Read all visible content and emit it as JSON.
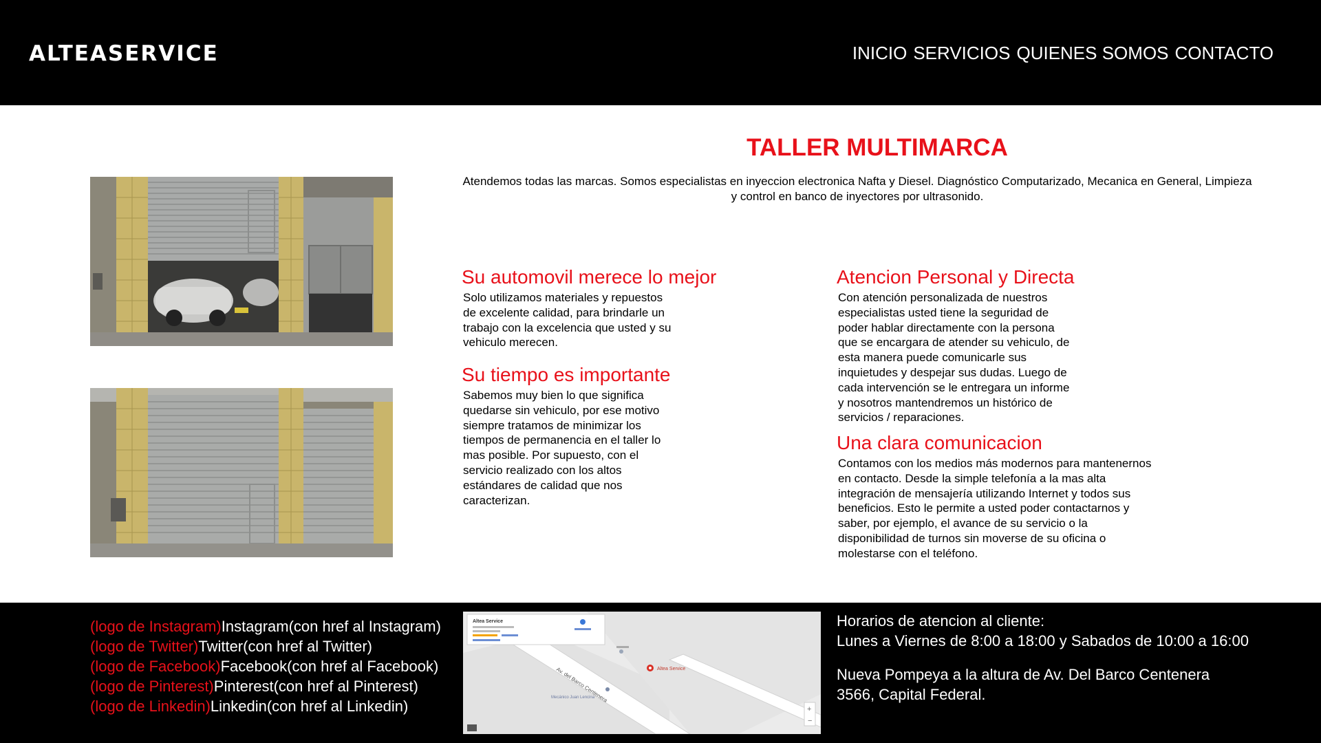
{
  "header": {
    "logo": "ALTEASERVICE",
    "nav": [
      "INICIO",
      "SERVICIOS",
      "QUIENES SOMOS",
      "CONTACTO"
    ]
  },
  "main": {
    "title": "TALLER MULTIMARCA",
    "intro": "Atendemos todas las marcas. Somos especialistas en inyeccion electronica Nafta y Diesel. Diagnóstico Computarizado, Mecanica en General, Limpieza y control en banco de inyectores por ultrasonido.",
    "features": [
      {
        "heading": "Su automovil merece lo mejor",
        "text": "Solo utilizamos materiales y repuestos de excelente calidad, para brindarle un trabajo con la excelencia que usted y su vehiculo merecen."
      },
      {
        "heading": "Su tiempo es importante",
        "text": "Sabemos muy bien lo que significa quedarse sin vehiculo, por ese motivo siempre tratamos de minimizar los tiempos de permanencia en el taller lo mas posible. Por supuesto, con el servicio realizado con los altos estándares de calidad que nos caracterizan."
      },
      {
        "heading": "Atencion Personal y Directa",
        "text": "Con atención personalizada de nuestros especialistas usted tiene la seguridad de poder hablar directamente con la persona que se encargara de atender su vehiculo, de esta manera puede comunicarle sus inquietudes y despejar sus dudas. Luego de cada intervención se le entregara un informe y nosotros mantendremos un histórico de servicios / reparaciones."
      },
      {
        "heading": "Una clara comunicacion",
        "text": "Contamos con los medios más modernos para mantenernos en contacto. Desde la simple telefonía a la mas alta integración de mensajería utilizando Internet y todos sus beneficios. Esto le permite a usted poder contactarnos y saber, por ejemplo, el avance de su servicio o la disponibilidad de turnos sin moverse de su oficina o molestarse con el teléfono."
      }
    ]
  },
  "footer": {
    "socials": [
      {
        "logo": "(logo de Instagram)",
        "label": "Instagram(con href al Instagram)",
        "icon": "instagram-icon"
      },
      {
        "logo": "(logo de Twitter)",
        "label": "Twitter(con href al Twitter)",
        "icon": "twitter-icon"
      },
      {
        "logo": "(logo de Facebook)",
        "label": "Facebook(con href al Facebook)",
        "icon": "facebook-icon"
      },
      {
        "logo": "(logo de Pinterest)",
        "label": "Pinterest(con href al Pinterest)",
        "icon": "pinterest-icon"
      },
      {
        "logo": "(logo de Linkedin)",
        "label": "Linkedin(con href al Linkedin)",
        "icon": "linkedin-icon"
      }
    ],
    "map": {
      "place_card": "Altea Service",
      "street": "Av. del Barco Centenera",
      "marker_label": "Altea Service",
      "nearby": "Mecánico Juan Lencina"
    },
    "hours_title": "Horarios de atencion al cliente:",
    "hours": "Lunes a Viernes de 8:00 a 18:00 y Sabados de 10:00 a 16:00",
    "address": "Nueva Pompeya a la altura de Av. Del Barco Centenera 3566, Capital Federal."
  },
  "colors": {
    "accent": "#e8111a",
    "header_bg": "#000000",
    "footer_bg": "#000000",
    "map_bg": "#ebebeb"
  }
}
